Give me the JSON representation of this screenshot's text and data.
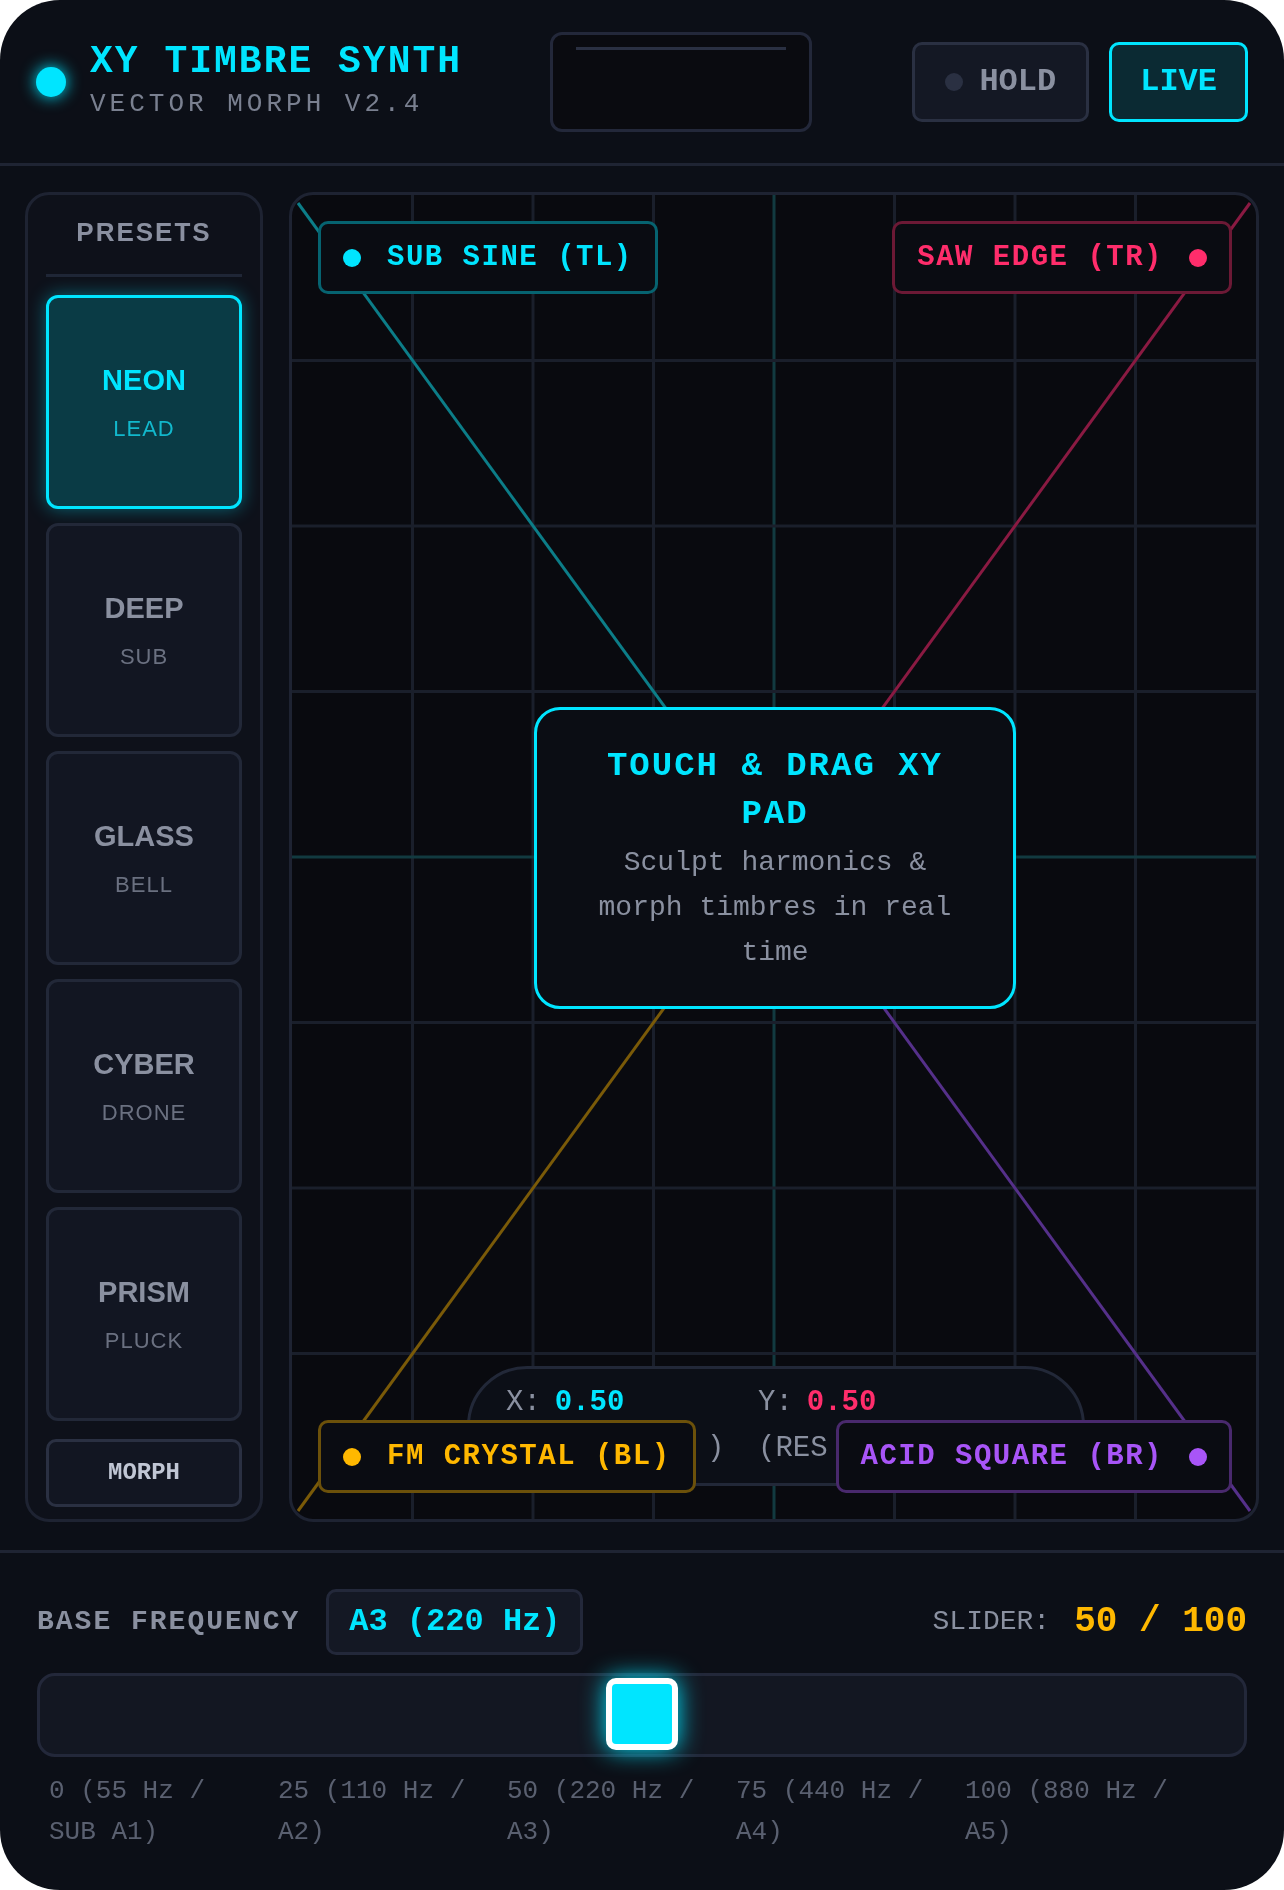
{
  "header": {
    "title": "XY TIMBRE SYNTH",
    "subtitle": "VECTOR MORPH V2.4",
    "buttons": [
      {
        "kind": "hold",
        "label": "HOLD",
        "on": false
      },
      {
        "kind": "live",
        "label": "LIVE",
        "on": true
      }
    ]
  },
  "presets": {
    "title": "PRESETS",
    "items": [
      {
        "name": "NEON",
        "type": "LEAD",
        "selected": true
      },
      {
        "name": "DEEP",
        "type": "SUB",
        "selected": false
      },
      {
        "name": "GLASS",
        "type": "BELL",
        "selected": false
      },
      {
        "name": "CYBER",
        "type": "DRONE",
        "selected": false
      },
      {
        "name": "PRISM",
        "type": "PLUCK",
        "selected": false
      }
    ],
    "morph_button": "MORPH"
  },
  "pad": {
    "corners": [
      {
        "label": "SUB SINE (TL)",
        "color": "#00e5ff"
      },
      {
        "label": "SAW EDGE (TR)",
        "color": "#ff2d6b"
      },
      {
        "label": "FM CRYSTAL (BL)",
        "color": "#ffb800"
      },
      {
        "label": "ACID SQUARE (BR)",
        "color": "#a855f7"
      }
    ],
    "hint_title": "TOUCH & DRAG XY PAD",
    "hint_text": "Sculpt harmonics & morph timbres in real time",
    "readout": {
      "x_label": "X:",
      "x_value": "0.50",
      "y_label": "Y:",
      "y_value": "0.50",
      "x_note": ")",
      "y_note": "(RES"
    }
  },
  "frequency": {
    "label": "BASE FREQUENCY",
    "note": "A3 (220 Hz)",
    "slider_label": "SLIDER:",
    "slider_value": "50 / 100",
    "level": 0.5,
    "ticks": [
      "0 (55 Hz / SUB A1)",
      "25 (110 Hz / A2)",
      "50 (220 Hz / A3)",
      "75 (440 Hz / A4)",
      "100 (880 Hz / A5)"
    ]
  }
}
